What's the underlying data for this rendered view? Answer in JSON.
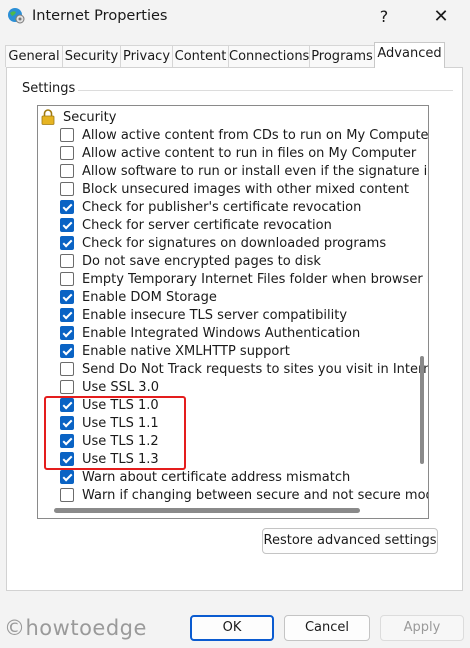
{
  "window": {
    "title": "Internet Properties",
    "help_label": "?",
    "close_label": "✕",
    "icon": "globe-settings-icon"
  },
  "tabs": [
    {
      "label": "General",
      "active": false
    },
    {
      "label": "Security",
      "active": false
    },
    {
      "label": "Privacy",
      "active": false
    },
    {
      "label": "Content",
      "active": false
    },
    {
      "label": "Connections",
      "active": false
    },
    {
      "label": "Programs",
      "active": false
    },
    {
      "label": "Advanced",
      "active": true
    }
  ],
  "settings": {
    "group_label": "Settings",
    "category": {
      "label": "Security",
      "icon": "lock-icon"
    },
    "items": [
      {
        "label": "Allow active content from CDs to run on My Computer",
        "checked": false
      },
      {
        "label": "Allow active content to run in files on My Computer",
        "checked": false
      },
      {
        "label": "Allow software to run or install even if the signature is inv",
        "checked": false
      },
      {
        "label": "Block unsecured images with other mixed content",
        "checked": false
      },
      {
        "label": "Check for publisher's certificate revocation",
        "checked": true
      },
      {
        "label": "Check for server certificate revocation",
        "checked": true
      },
      {
        "label": "Check for signatures on downloaded programs",
        "checked": true
      },
      {
        "label": "Do not save encrypted pages to disk",
        "checked": false
      },
      {
        "label": "Empty Temporary Internet Files folder when browser is cl",
        "checked": false
      },
      {
        "label": "Enable DOM Storage",
        "checked": true
      },
      {
        "label": "Enable insecure TLS server compatibility",
        "checked": true
      },
      {
        "label": "Enable Integrated Windows Authentication",
        "checked": true
      },
      {
        "label": "Enable native XMLHTTP support",
        "checked": true
      },
      {
        "label": "Send Do Not Track requests to sites you visit in Internet E",
        "checked": false
      },
      {
        "label": "Use SSL 3.0",
        "checked": false
      },
      {
        "label": "Use TLS 1.0",
        "checked": true
      },
      {
        "label": "Use TLS 1.1",
        "checked": true
      },
      {
        "label": "Use TLS 1.2",
        "checked": true
      },
      {
        "label": "Use TLS 1.3",
        "checked": true
      },
      {
        "label": "Warn about certificate address mismatch",
        "checked": true
      },
      {
        "label": "Warn if changing between secure and not secure mode",
        "checked": false
      }
    ]
  },
  "buttons": {
    "restore": "Restore advanced settings",
    "ok": "OK",
    "cancel": "Cancel",
    "apply": "Apply"
  },
  "watermark": "©howtoedge",
  "colors": {
    "checkbox_checked": "#0a63c4",
    "highlight": "#e41d1d",
    "ok_border": "#0a5bd0"
  }
}
